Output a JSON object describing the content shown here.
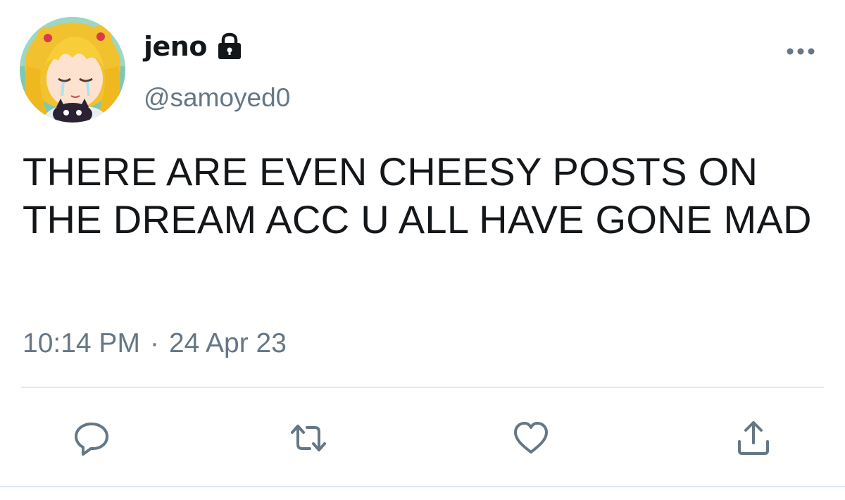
{
  "user": {
    "display_name": "jeno",
    "handle": "@samoyed0",
    "avatar_icon": "avatar-anime-girl",
    "locked_icon": "lock-icon"
  },
  "tweet": {
    "text": "THERE ARE EVEN CHEESY POSTS ON THE DREAM ACC U ALL HAVE GONE MAD",
    "time": "10:14 PM",
    "separator": "·",
    "date": "24 Apr 23"
  },
  "actions": {
    "reply_icon": "speech-bubble-icon",
    "retweet_icon": "retweet-icon",
    "like_icon": "heart-icon",
    "share_icon": "share-icon"
  },
  "colors": {
    "text": "#14171a",
    "secondary": "#657786",
    "icon": "#657786",
    "divider": "#e1e8ed"
  }
}
